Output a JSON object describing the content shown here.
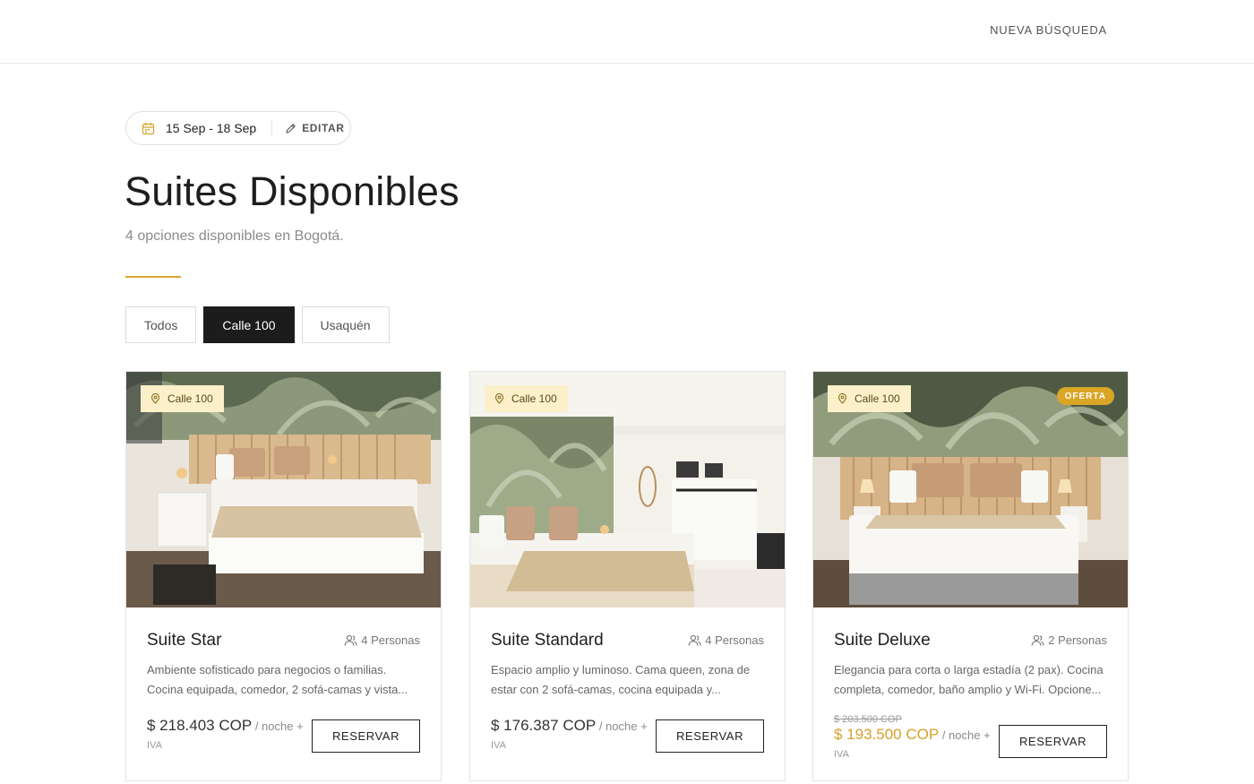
{
  "header": {
    "nav_link": "NUEVA BÚSQUEDA"
  },
  "dates": {
    "range": "15 Sep - 18 Sep",
    "edit_label": "EDITAR"
  },
  "main": {
    "title": "Suites Disponibles",
    "subtitle": "4 opciones disponibles en Bogotá.",
    "accent_color": "#d8a72e"
  },
  "filters": {
    "items": [
      {
        "label": "Todos",
        "active": false
      },
      {
        "label": "Calle 100",
        "active": true
      },
      {
        "label": "Usaquén",
        "active": false
      }
    ]
  },
  "cards": [
    {
      "location": "Calle 100",
      "name": "Suite Star",
      "capacity": "4 Personas",
      "description": "Ambiente sofisticado para negocios o familias. Cocina equipada, comedor, 2 sofá-camas y vista...",
      "price": "$ 218.403 COP",
      "per_night": " / noche +",
      "iva": "IVA",
      "reserve_label": "RESERVAR"
    },
    {
      "location": "Calle 100",
      "name": "Suite Standard",
      "capacity": "4 Personas",
      "description": "Espacio amplio y luminoso. Cama queen, zona de estar con 2 sofá-camas, cocina equipada y...",
      "price": "$ 176.387 COP",
      "per_night": " / noche +",
      "iva": "IVA",
      "reserve_label": "RESERVAR"
    },
    {
      "location": "Calle 100",
      "badge": "OFERTA",
      "name": "Suite Deluxe",
      "capacity": "2 Personas",
      "description": "Elegancia para corta o larga estadía (2 pax). Cocina completa, comedor, baño amplio y Wi-Fi. Opcione...",
      "old_price": "$ 203.500 COP",
      "price": "$ 193.500 COP",
      "per_night": " / noche +",
      "iva": "IVA",
      "reserve_label": "RESERVAR"
    }
  ],
  "icons": {
    "calendar": "calendar-icon",
    "edit": "pencil-icon",
    "location": "map-pin-icon",
    "capacity": "people-icon"
  }
}
